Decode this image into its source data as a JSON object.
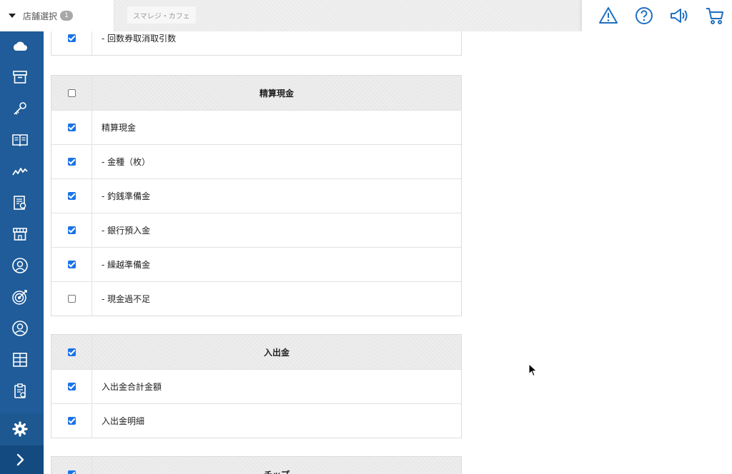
{
  "header": {
    "store_select_label": "店舗選択",
    "store_count": "1",
    "store_name": "スマレジ・カフェ",
    "icons": [
      "warning-icon",
      "help-icon",
      "megaphone-icon",
      "cart-icon"
    ],
    "accent_color": "#1f5c99"
  },
  "sidebar": {
    "icons": [
      "cloud-icon",
      "archive-box-icon",
      "key-icon",
      "book-icon",
      "chart-line-icon",
      "report-icon",
      "store-icon",
      "customer-icon",
      "target-icon",
      "user-icon",
      "table-icon",
      "clipboard-check-icon",
      "gear-icon",
      "chevron-right-icon"
    ]
  },
  "sections": [
    {
      "rows": [
        {
          "label": "- 回数券取消取引数",
          "checked": true
        }
      ]
    },
    {
      "title": "精算現金",
      "title_checked": false,
      "rows": [
        {
          "label": "精算現金",
          "checked": true
        },
        {
          "label": "- 金種（枚）",
          "checked": true
        },
        {
          "label": "- 釣銭準備金",
          "checked": true
        },
        {
          "label": "- 銀行預入金",
          "checked": true
        },
        {
          "label": "- 繰越準備金",
          "checked": true
        },
        {
          "label": "- 現金過不足",
          "checked": false
        }
      ]
    },
    {
      "title": "入出金",
      "title_checked": true,
      "rows": [
        {
          "label": "入出金合計金額",
          "checked": true
        },
        {
          "label": "入出金明細",
          "checked": true
        }
      ]
    },
    {
      "title": "チップ",
      "title_checked": true,
      "rows": []
    }
  ]
}
